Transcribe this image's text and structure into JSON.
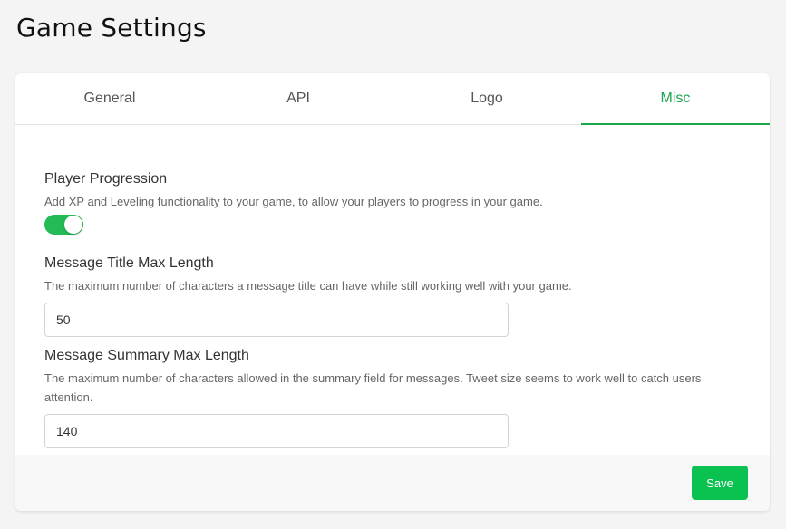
{
  "page": {
    "title": "Game Settings"
  },
  "tabs": [
    {
      "label": "General",
      "active": false
    },
    {
      "label": "API",
      "active": false
    },
    {
      "label": "Logo",
      "active": false
    },
    {
      "label": "Misc",
      "active": true
    }
  ],
  "settings": {
    "player_progression": {
      "label": "Player Progression",
      "description": "Add XP and Leveling functionality to your game, to allow your players to progress in your game.",
      "enabled": true
    },
    "title_max_length": {
      "label": "Message Title Max Length",
      "description": "The maximum number of characters a message title can have while still working well with your game.",
      "value": "50"
    },
    "summary_max_length": {
      "label": "Message Summary Max Length",
      "description": "The maximum number of characters allowed in the summary field for messages. Tweet size seems to work well to catch users attention.",
      "value": "140"
    }
  },
  "footer": {
    "save_label": "Save"
  },
  "colors": {
    "accent": "#1aa64a",
    "button": "#0bc150",
    "toggle_on": "#22bb55"
  }
}
